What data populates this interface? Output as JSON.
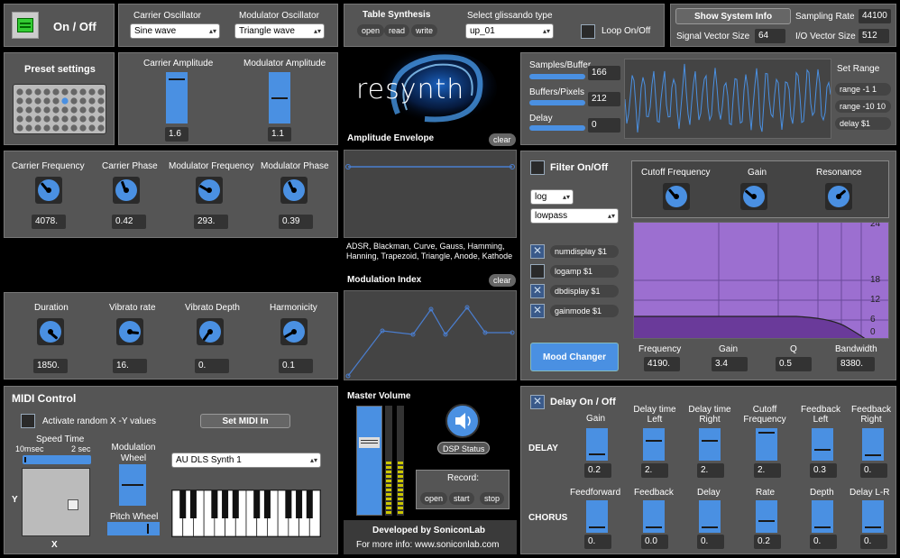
{
  "top": {
    "onoff": "On / Off",
    "carrier_osc_label": "Carrier Oscillator",
    "carrier_osc_value": "Sine wave",
    "mod_osc_label": "Modulator Oscillator",
    "mod_osc_value": "Triangle wave",
    "table_synth": "Table Synthesis",
    "open": "open",
    "read": "read",
    "write": "write",
    "gliss_label": "Select glissando type",
    "gliss_value": "up_01",
    "loop": "Loop On/Off",
    "show_sys": "Show System Info",
    "sampling_rate_label": "Sampling Rate",
    "sampling_rate": "44100",
    "svs_label": "Signal Vector Size",
    "svs": "64",
    "io_label": "I/O Vector Size",
    "io": "512"
  },
  "preset": {
    "title": "Preset settings"
  },
  "amps": {
    "carrier_label": "Carrier Amplitude",
    "carrier_value": "1.6",
    "carrier_level": 0.9,
    "mod_label": "Modulator Amplitude",
    "mod_value": "1.1",
    "mod_level": 0.5
  },
  "logo": {
    "text": "resynth"
  },
  "envelope": {
    "title": "Amplitude Envelope",
    "clear": "clear",
    "types": "ADSR, Blackman, Curve, Gauss, Hamming, Hanning, Trapezoid, Triangle, Anode, Kathode"
  },
  "modindex": {
    "title": "Modulation Index",
    "clear": "clear"
  },
  "buffers": {
    "samples_label": "Samples/Buffer",
    "samples": "166",
    "buffers_label": "Buffers/Pixels",
    "buffers": "212",
    "delay_label": "Delay",
    "delay": "0",
    "setrange": "Set Range",
    "r1": "range -1 1",
    "r2": "range -10 10",
    "r3": "delay $1"
  },
  "freqs": {
    "cf_label": "Carrier Frequency",
    "cf": "4078.",
    "cp_label": "Carrier Phase",
    "cp": "0.42",
    "mf_label": "Modulator Frequency",
    "mf": "293.",
    "mp_label": "Modulator Phase",
    "mp": "0.39"
  },
  "vib": {
    "dur_label": "Duration",
    "dur": "1850.",
    "vr_label": "Vibrato rate",
    "vr": "16.",
    "vd_label": "Vibrato Depth",
    "vd": "0.",
    "harm_label": "Harmonicity",
    "harm": "0.1"
  },
  "filter": {
    "title": "Filter On/Off",
    "scale": "log",
    "type": "lowpass",
    "cutoff_label": "Cutoff Frequency",
    "gain_label": "Gain",
    "res_label": "Resonance",
    "m1": "numdisplay $1",
    "m2": "logamp $1",
    "m3": "dbdisplay $1",
    "m4": "gainmode $1",
    "mood": "Mood Changer",
    "freq_label": "Frequency",
    "freq": "4190.",
    "gain2_label": "Gain",
    "gain2": "3.4",
    "q_label": "Q",
    "q": "0.5",
    "bw_label": "Bandwidth",
    "bw": "8380.",
    "ticks": [
      "24",
      "18",
      "12",
      "6",
      "0"
    ]
  },
  "midi": {
    "title": "MIDI Control",
    "activate": "Activate random X -Y values",
    "set_midi": "Set MIDI In",
    "speed": "Speed Time",
    "min": "10msec",
    "max": "2 sec",
    "y": "Y",
    "x": "X",
    "modwheel": "Modulation Wheel",
    "pitchwheel": "Pitch Wheel",
    "synth": "AU DLS Synth 1"
  },
  "master": {
    "title": "Master Volume",
    "dsp": "DSP Status",
    "record": "Record:",
    "open": "open",
    "start": "start",
    "stop": "stop",
    "dev": "Developed by SoniconLab",
    "info": "For more info: www.soniconlab.com"
  },
  "delay": {
    "title": "Delay On / Off",
    "delay_label": "DELAY",
    "chorus_label": "CHORUS",
    "d_labels": [
      "Gain",
      "Delay time Left",
      "Delay time Right",
      "Cutoff Frequency",
      "Feedback Left",
      "Feedback Right"
    ],
    "d_values": [
      "0.2",
      "2.",
      "2.",
      "2.",
      "0.3",
      "0."
    ],
    "d_levels": [
      0.15,
      0.65,
      0.65,
      0.95,
      0.3,
      0.1
    ],
    "c_labels": [
      "Feedforward",
      "Feedback",
      "Delay",
      "Rate",
      "Depth",
      "Delay L-R"
    ],
    "c_values": [
      "0.",
      "0.0",
      "0.",
      "0.2",
      "0.",
      "0."
    ],
    "c_levels": [
      0.1,
      0.1,
      0.1,
      0.35,
      0.1,
      0.1
    ]
  },
  "colors": {
    "accent": "#4a90e2",
    "panel": "#555555",
    "filter_fill": "#9c6fd0"
  }
}
